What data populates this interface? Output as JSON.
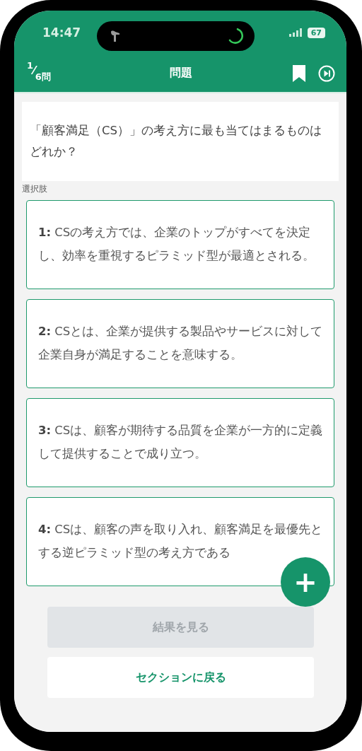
{
  "status_bar": {
    "time": "14:47",
    "battery": "67"
  },
  "header": {
    "counter": {
      "current": "1",
      "separator": "⁄",
      "total": "6問"
    },
    "title": "問題"
  },
  "question": "「顧客満足（CS）」の考え方に最も当てはまるものはどれか？",
  "choices_label": "選択肢",
  "choices": [
    {
      "text": "**1:** CSの考え方では、企業のトップがすべてを決定し、効率を重視するピラミッド型が最適とされる。",
      "selected": false
    },
    {
      "text": "**2:** CSとは、企業が提供する製品やサービスに対して企業自身が満足することを意味する。",
      "selected": false
    },
    {
      "text": "**3:** CSは、顧客が期待する品質を企業が一方的に定義して提供することで成り立つ。",
      "selected": false
    },
    {
      "text": "**4:** CSは、顧客の声を取り入れ、顧客満足を最優先とする逆ピラミッド型の考え方である",
      "selected": false
    }
  ],
  "fab": {
    "label": "+"
  },
  "buttons": [
    {
      "label": "結果を見る",
      "kind": "primary",
      "disabled": true
    },
    {
      "label": "セクションに戻る",
      "kind": "secondary",
      "disabled": false
    }
  ]
}
